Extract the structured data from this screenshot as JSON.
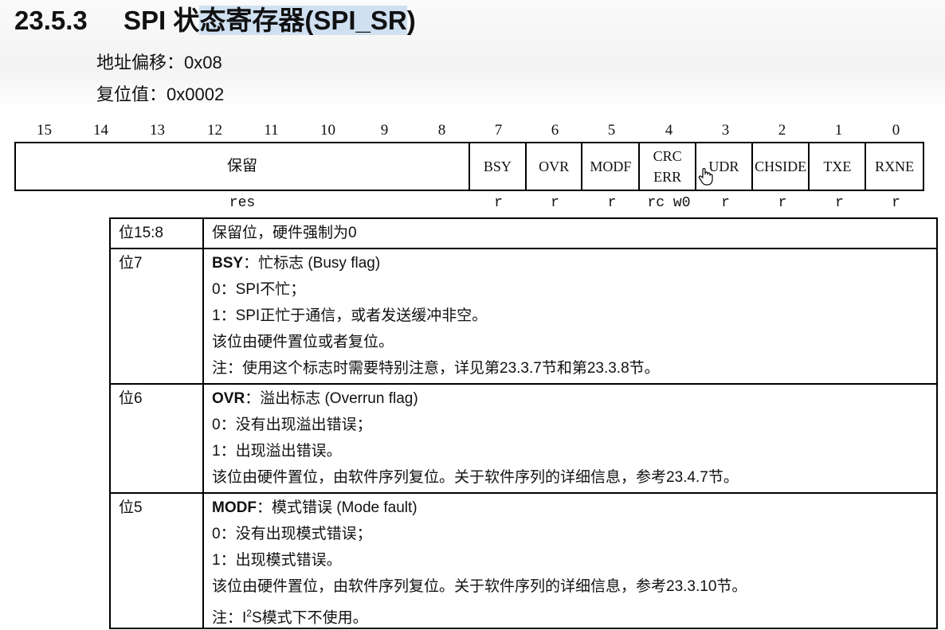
{
  "header": {
    "section": "23.5.3",
    "title_prefix": "SPI 状",
    "title_highlight": "态寄存器(SPI_SR",
    "title_suffix": ")"
  },
  "meta": {
    "offset": "地址偏移：0x08",
    "reset": "复位值：0x0002"
  },
  "register": {
    "bit_numbers": [
      "15",
      "14",
      "13",
      "12",
      "11",
      "10",
      "9",
      "8",
      "7",
      "6",
      "5",
      "4",
      "3",
      "2",
      "1",
      "0"
    ],
    "fields": [
      {
        "name": "保留",
        "access": "res"
      },
      {
        "name": "BSY",
        "access": "r"
      },
      {
        "name": "OVR",
        "access": "r"
      },
      {
        "name": "MODF",
        "access": "r"
      },
      {
        "name_line1": "CRC",
        "name_line2": "ERR",
        "access": "rc w0"
      },
      {
        "name": "UDR",
        "access": "r"
      },
      {
        "name": "CHSIDE",
        "access": "r"
      },
      {
        "name": "TXE",
        "access": "r"
      },
      {
        "name": "RXNE",
        "access": "r"
      }
    ]
  },
  "descriptions": [
    {
      "bit": "位15:8",
      "lines": [
        "保留位，硬件强制为0"
      ]
    },
    {
      "bit": "位7",
      "field": "BSY",
      "field_desc": "：忙标志 (Busy flag)",
      "lines": [
        "0：SPI不忙；",
        "1：SPI正忙于通信，或者发送缓冲非空。",
        "该位由硬件置位或者复位。",
        "注：使用这个标志时需要特别注意，详见第23.3.7节和第23.3.8节。"
      ]
    },
    {
      "bit": "位6",
      "field": "OVR",
      "field_desc": "：溢出标志 (Overrun flag)",
      "lines": [
        "0：没有出现溢出错误；",
        "1：出现溢出错误。",
        "该位由硬件置位，由软件序列复位。关于软件序列的详细信息，参考23.4.7节。"
      ]
    },
    {
      "bit": "位5",
      "field": "MODF",
      "field_desc": "：模式错误 (Mode fault)",
      "lines": [
        "0：没有出现模式错误；",
        "1：出现模式错误。",
        "该位由硬件置位，由软件序列复位。关于软件序列的详细信息，参考23.3.10节。"
      ],
      "note_pre": "注：I",
      "note_sup": "2",
      "note_post": "S模式下不使用。"
    }
  ]
}
